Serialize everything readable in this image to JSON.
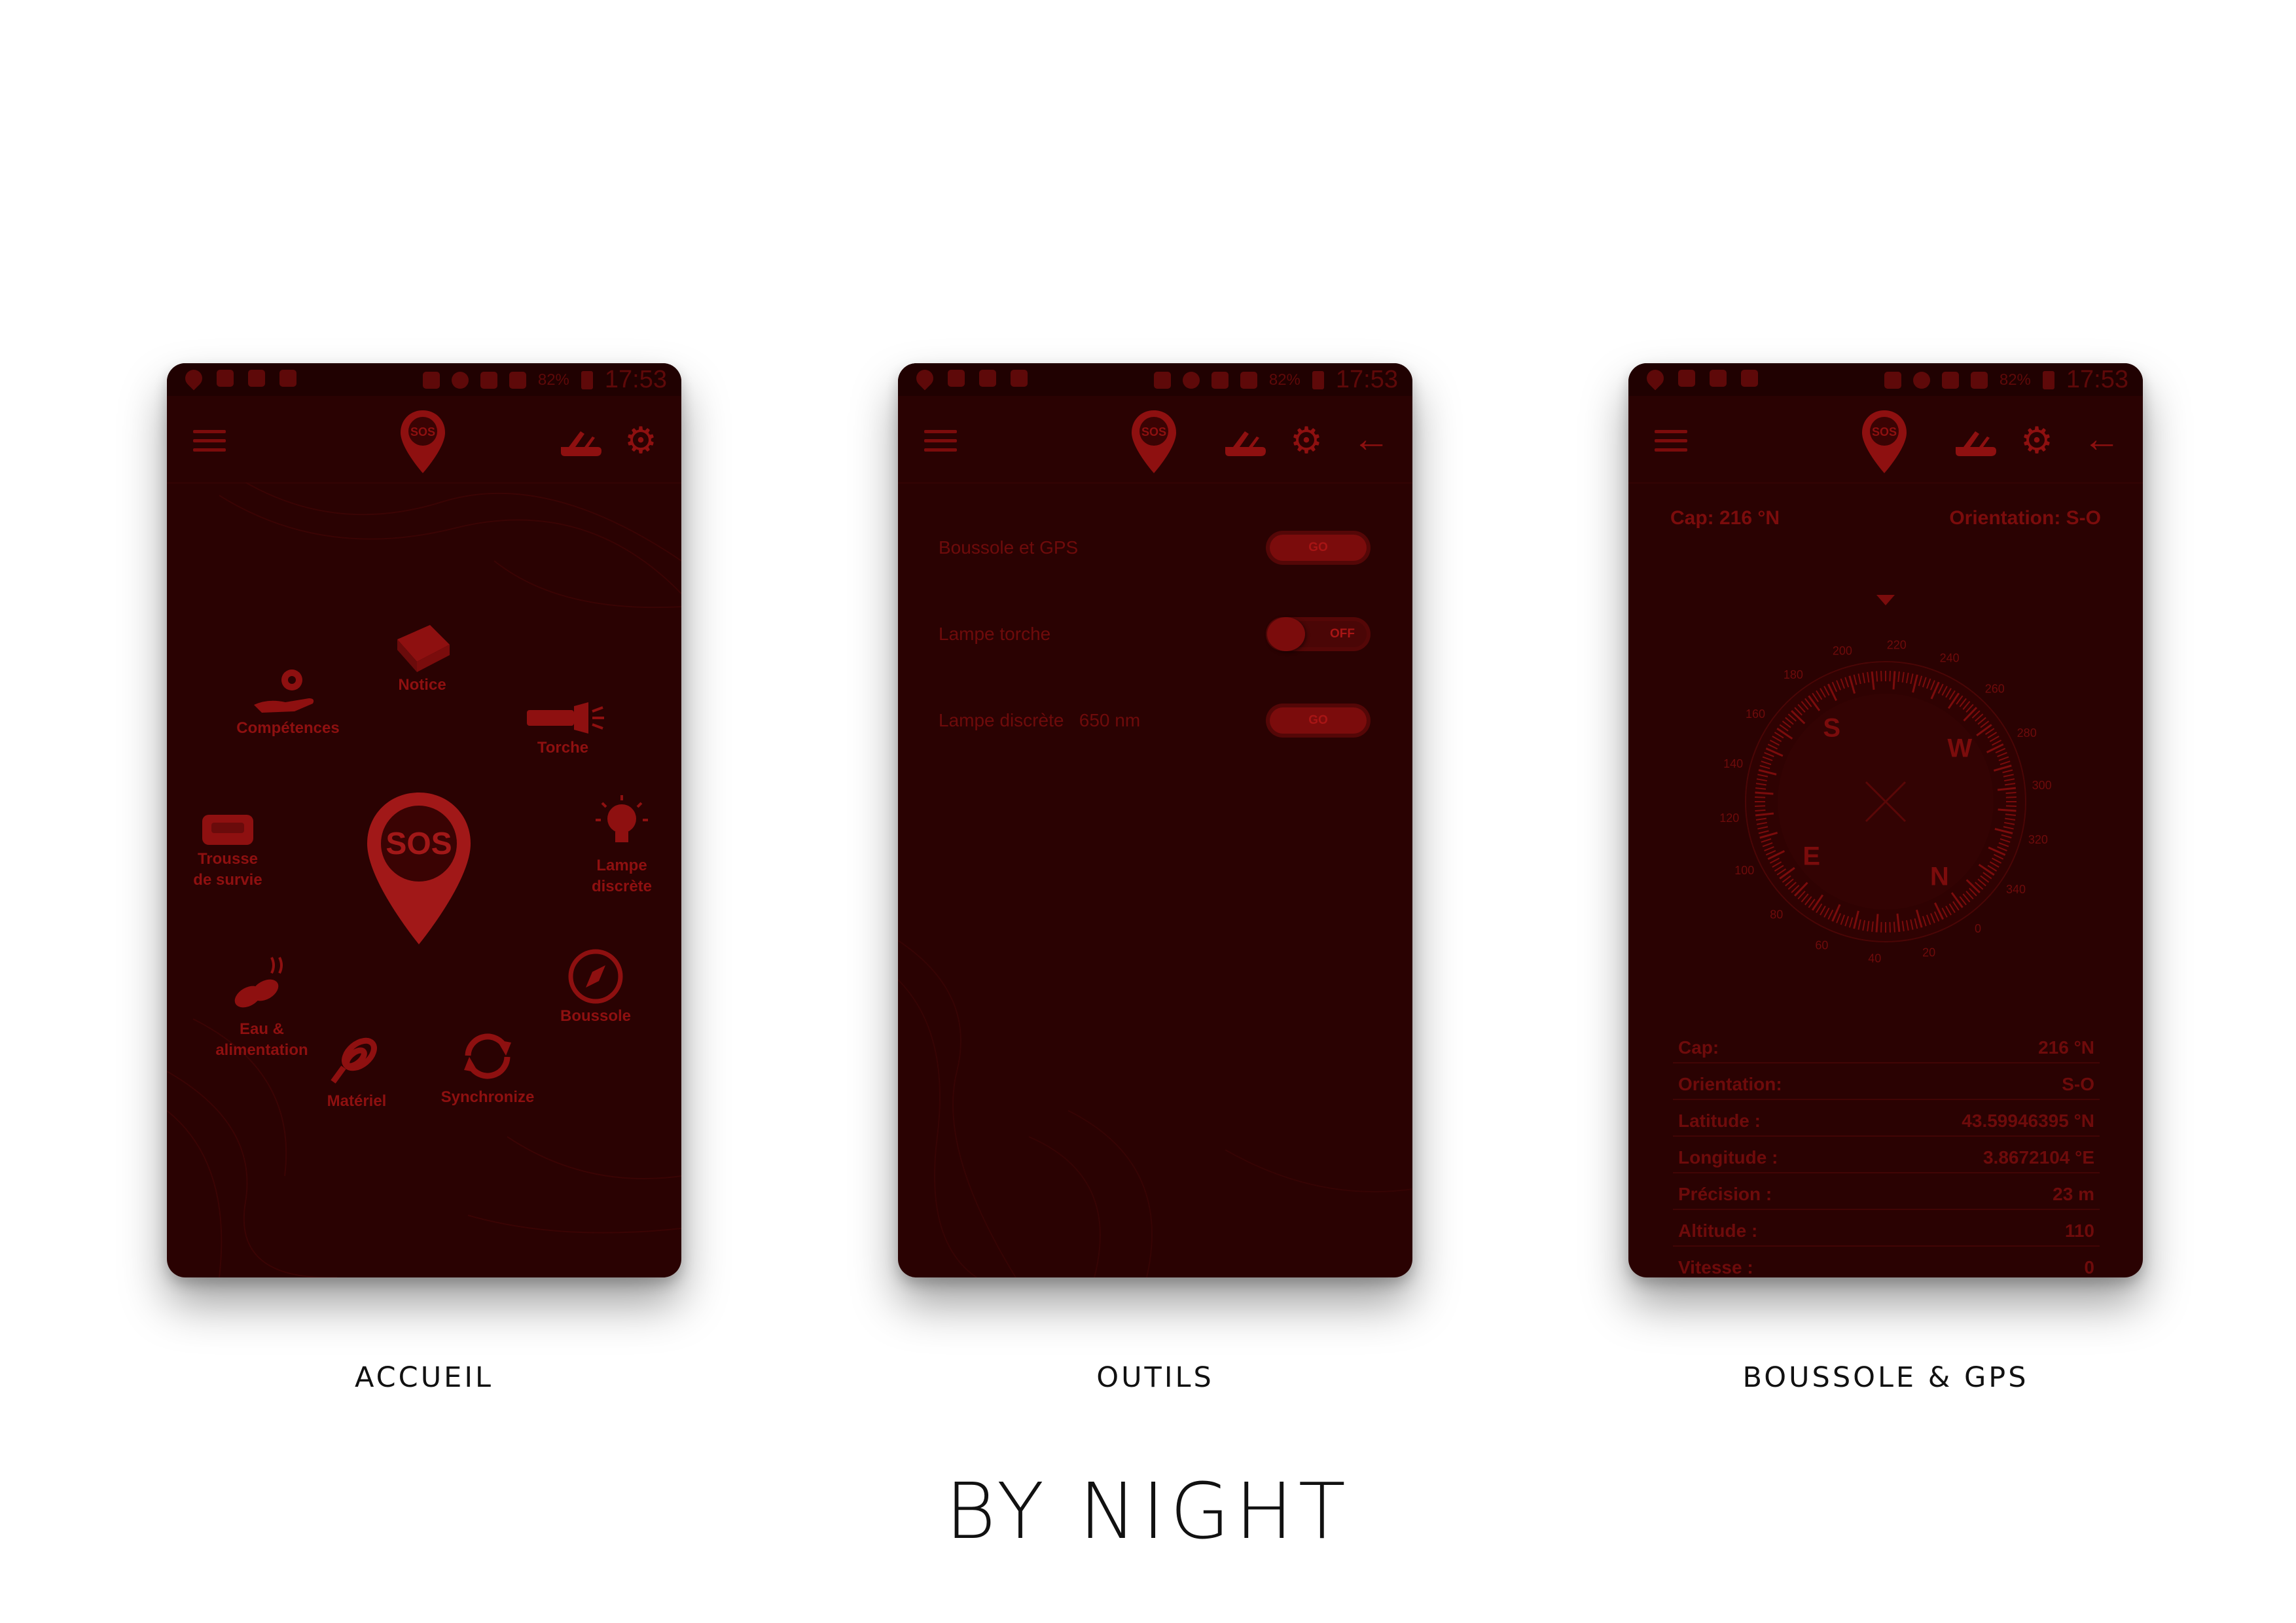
{
  "title": "BY NIGHT",
  "colors": {
    "phone_bg": "#2a0202",
    "accent": "#8e1010",
    "sos_red": "#a11818",
    "page_bg": "#ffffff"
  },
  "statusbar": {
    "battery": "82%",
    "time": "17:53"
  },
  "captions": [
    "ACCUEIL",
    "OUTILS",
    "BOUSSOLE & GPS"
  ],
  "accueil": {
    "sos_label": "SOS",
    "features": {
      "notice": "Notice",
      "competences": "Compétences",
      "torche": "Torche",
      "trousse": "Trousse\nde survie",
      "lampe": "Lampe\ndiscrète",
      "eau": "Eau &\nalimentation",
      "boussole": "Boussole",
      "materiel": "Matériel",
      "synchronize": "Synchronize"
    }
  },
  "outils": {
    "tools": [
      {
        "label": "Boussole et GPS",
        "toggle": "GO"
      },
      {
        "label": "Lampe torche",
        "toggle": "OFF"
      },
      {
        "label": "Lampe discrète   650 nm",
        "toggle": "GO"
      }
    ]
  },
  "boussole": {
    "cap_header": "Cap: 216 °N",
    "orientation_header": "Orientation: S-O",
    "compass": {
      "heading": 216,
      "cardinals": [
        "S",
        "W",
        "N",
        "E"
      ],
      "degree_labels": [
        "200",
        "220",
        "240",
        "260",
        "280",
        "300",
        "320",
        "340",
        "0",
        "20",
        "40",
        "60",
        "80",
        "100",
        "120",
        "140",
        "160",
        "180"
      ]
    },
    "rows": [
      {
        "key": "Cap:",
        "value": "216 °N"
      },
      {
        "key": "Orientation:",
        "value": "S-O"
      },
      {
        "key": "Latitude :",
        "value": "43.59946395 °N"
      },
      {
        "key": "Longitude :",
        "value": "3.8672104 °E"
      },
      {
        "key": "Précision :",
        "value": "23 m"
      },
      {
        "key": "Altitude :",
        "value": "110"
      },
      {
        "key": "Vitesse :",
        "value": "0"
      }
    ]
  }
}
